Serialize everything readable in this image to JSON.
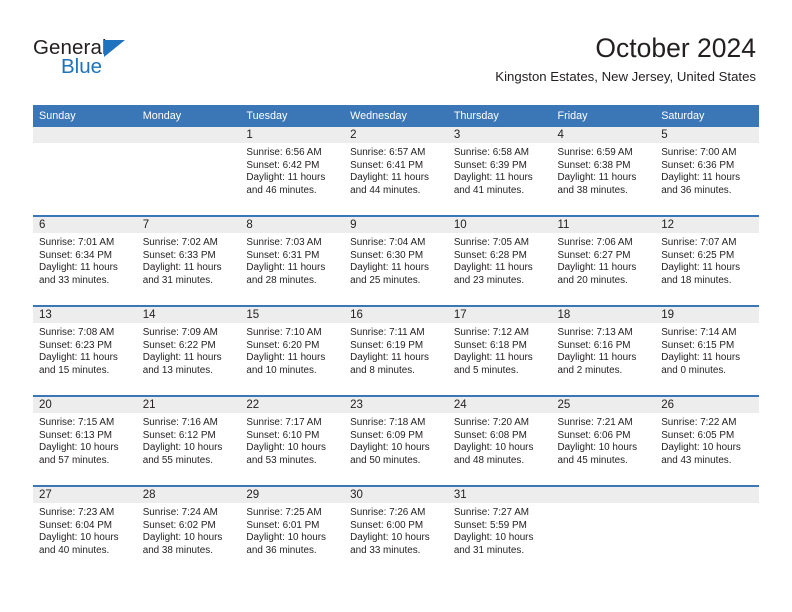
{
  "brand": {
    "name_part1": "General",
    "name_part2": "Blue",
    "accent_color": "#1f72bd"
  },
  "header": {
    "month_title": "October 2024",
    "location": "Kingston Estates, New Jersey, United States"
  },
  "theme": {
    "header_blue": "#3b76b7",
    "daynum_band": "#ededed",
    "text": "#231f20"
  },
  "calendar": {
    "weekday_headers": [
      "Sunday",
      "Monday",
      "Tuesday",
      "Wednesday",
      "Thursday",
      "Friday",
      "Saturday"
    ],
    "weeks": [
      [
        {
          "empty": true
        },
        {
          "empty": true
        },
        {
          "day": "1",
          "sunrise": "Sunrise: 6:56 AM",
          "sunset": "Sunset: 6:42 PM",
          "daylight_line1": "Daylight: 11 hours",
          "daylight_line2": "and 46 minutes."
        },
        {
          "day": "2",
          "sunrise": "Sunrise: 6:57 AM",
          "sunset": "Sunset: 6:41 PM",
          "daylight_line1": "Daylight: 11 hours",
          "daylight_line2": "and 44 minutes."
        },
        {
          "day": "3",
          "sunrise": "Sunrise: 6:58 AM",
          "sunset": "Sunset: 6:39 PM",
          "daylight_line1": "Daylight: 11 hours",
          "daylight_line2": "and 41 minutes."
        },
        {
          "day": "4",
          "sunrise": "Sunrise: 6:59 AM",
          "sunset": "Sunset: 6:38 PM",
          "daylight_line1": "Daylight: 11 hours",
          "daylight_line2": "and 38 minutes."
        },
        {
          "day": "5",
          "sunrise": "Sunrise: 7:00 AM",
          "sunset": "Sunset: 6:36 PM",
          "daylight_line1": "Daylight: 11 hours",
          "daylight_line2": "and 36 minutes."
        }
      ],
      [
        {
          "day": "6",
          "sunrise": "Sunrise: 7:01 AM",
          "sunset": "Sunset: 6:34 PM",
          "daylight_line1": "Daylight: 11 hours",
          "daylight_line2": "and 33 minutes."
        },
        {
          "day": "7",
          "sunrise": "Sunrise: 7:02 AM",
          "sunset": "Sunset: 6:33 PM",
          "daylight_line1": "Daylight: 11 hours",
          "daylight_line2": "and 31 minutes."
        },
        {
          "day": "8",
          "sunrise": "Sunrise: 7:03 AM",
          "sunset": "Sunset: 6:31 PM",
          "daylight_line1": "Daylight: 11 hours",
          "daylight_line2": "and 28 minutes."
        },
        {
          "day": "9",
          "sunrise": "Sunrise: 7:04 AM",
          "sunset": "Sunset: 6:30 PM",
          "daylight_line1": "Daylight: 11 hours",
          "daylight_line2": "and 25 minutes."
        },
        {
          "day": "10",
          "sunrise": "Sunrise: 7:05 AM",
          "sunset": "Sunset: 6:28 PM",
          "daylight_line1": "Daylight: 11 hours",
          "daylight_line2": "and 23 minutes."
        },
        {
          "day": "11",
          "sunrise": "Sunrise: 7:06 AM",
          "sunset": "Sunset: 6:27 PM",
          "daylight_line1": "Daylight: 11 hours",
          "daylight_line2": "and 20 minutes."
        },
        {
          "day": "12",
          "sunrise": "Sunrise: 7:07 AM",
          "sunset": "Sunset: 6:25 PM",
          "daylight_line1": "Daylight: 11 hours",
          "daylight_line2": "and 18 minutes."
        }
      ],
      [
        {
          "day": "13",
          "sunrise": "Sunrise: 7:08 AM",
          "sunset": "Sunset: 6:23 PM",
          "daylight_line1": "Daylight: 11 hours",
          "daylight_line2": "and 15 minutes."
        },
        {
          "day": "14",
          "sunrise": "Sunrise: 7:09 AM",
          "sunset": "Sunset: 6:22 PM",
          "daylight_line1": "Daylight: 11 hours",
          "daylight_line2": "and 13 minutes."
        },
        {
          "day": "15",
          "sunrise": "Sunrise: 7:10 AM",
          "sunset": "Sunset: 6:20 PM",
          "daylight_line1": "Daylight: 11 hours",
          "daylight_line2": "and 10 minutes."
        },
        {
          "day": "16",
          "sunrise": "Sunrise: 7:11 AM",
          "sunset": "Sunset: 6:19 PM",
          "daylight_line1": "Daylight: 11 hours",
          "daylight_line2": "and 8 minutes."
        },
        {
          "day": "17",
          "sunrise": "Sunrise: 7:12 AM",
          "sunset": "Sunset: 6:18 PM",
          "daylight_line1": "Daylight: 11 hours",
          "daylight_line2": "and 5 minutes."
        },
        {
          "day": "18",
          "sunrise": "Sunrise: 7:13 AM",
          "sunset": "Sunset: 6:16 PM",
          "daylight_line1": "Daylight: 11 hours",
          "daylight_line2": "and 2 minutes."
        },
        {
          "day": "19",
          "sunrise": "Sunrise: 7:14 AM",
          "sunset": "Sunset: 6:15 PM",
          "daylight_line1": "Daylight: 11 hours",
          "daylight_line2": "and 0 minutes."
        }
      ],
      [
        {
          "day": "20",
          "sunrise": "Sunrise: 7:15 AM",
          "sunset": "Sunset: 6:13 PM",
          "daylight_line1": "Daylight: 10 hours",
          "daylight_line2": "and 57 minutes."
        },
        {
          "day": "21",
          "sunrise": "Sunrise: 7:16 AM",
          "sunset": "Sunset: 6:12 PM",
          "daylight_line1": "Daylight: 10 hours",
          "daylight_line2": "and 55 minutes."
        },
        {
          "day": "22",
          "sunrise": "Sunrise: 7:17 AM",
          "sunset": "Sunset: 6:10 PM",
          "daylight_line1": "Daylight: 10 hours",
          "daylight_line2": "and 53 minutes."
        },
        {
          "day": "23",
          "sunrise": "Sunrise: 7:18 AM",
          "sunset": "Sunset: 6:09 PM",
          "daylight_line1": "Daylight: 10 hours",
          "daylight_line2": "and 50 minutes."
        },
        {
          "day": "24",
          "sunrise": "Sunrise: 7:20 AM",
          "sunset": "Sunset: 6:08 PM",
          "daylight_line1": "Daylight: 10 hours",
          "daylight_line2": "and 48 minutes."
        },
        {
          "day": "25",
          "sunrise": "Sunrise: 7:21 AM",
          "sunset": "Sunset: 6:06 PM",
          "daylight_line1": "Daylight: 10 hours",
          "daylight_line2": "and 45 minutes."
        },
        {
          "day": "26",
          "sunrise": "Sunrise: 7:22 AM",
          "sunset": "Sunset: 6:05 PM",
          "daylight_line1": "Daylight: 10 hours",
          "daylight_line2": "and 43 minutes."
        }
      ],
      [
        {
          "day": "27",
          "sunrise": "Sunrise: 7:23 AM",
          "sunset": "Sunset: 6:04 PM",
          "daylight_line1": "Daylight: 10 hours",
          "daylight_line2": "and 40 minutes."
        },
        {
          "day": "28",
          "sunrise": "Sunrise: 7:24 AM",
          "sunset": "Sunset: 6:02 PM",
          "daylight_line1": "Daylight: 10 hours",
          "daylight_line2": "and 38 minutes."
        },
        {
          "day": "29",
          "sunrise": "Sunrise: 7:25 AM",
          "sunset": "Sunset: 6:01 PM",
          "daylight_line1": "Daylight: 10 hours",
          "daylight_line2": "and 36 minutes."
        },
        {
          "day": "30",
          "sunrise": "Sunrise: 7:26 AM",
          "sunset": "Sunset: 6:00 PM",
          "daylight_line1": "Daylight: 10 hours",
          "daylight_line2": "and 33 minutes."
        },
        {
          "day": "31",
          "sunrise": "Sunrise: 7:27 AM",
          "sunset": "Sunset: 5:59 PM",
          "daylight_line1": "Daylight: 10 hours",
          "daylight_line2": "and 31 minutes."
        },
        {
          "empty": true
        },
        {
          "empty": true
        }
      ]
    ]
  }
}
